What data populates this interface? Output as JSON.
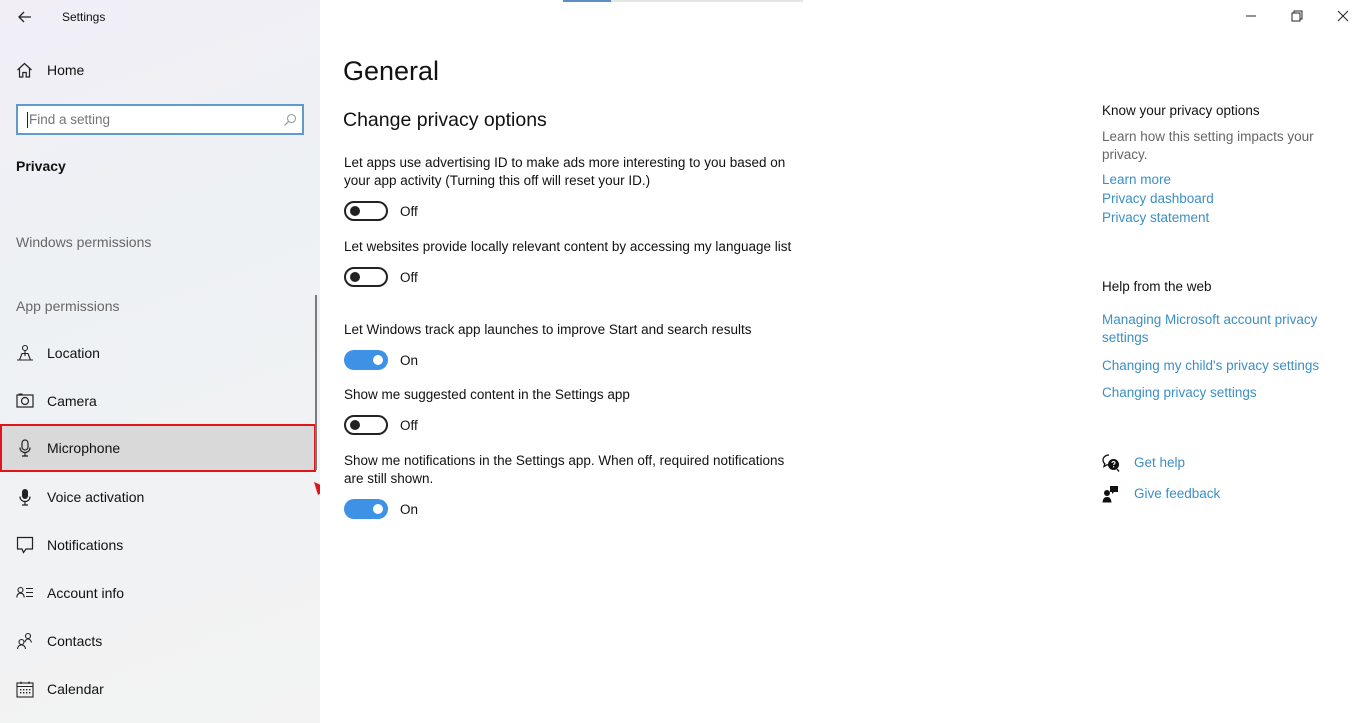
{
  "window": {
    "title": "Settings",
    "controls": {
      "minimize": "minimize",
      "restore": "restore",
      "close": "close"
    }
  },
  "sidebar": {
    "home_label": "Home",
    "search": {
      "placeholder": "Find a setting",
      "value": ""
    },
    "section_title": "Privacy",
    "groups": {
      "windows_permissions": "Windows permissions",
      "app_permissions": "App permissions"
    },
    "items": [
      {
        "label": "Location",
        "icon": "location-icon"
      },
      {
        "label": "Camera",
        "icon": "camera-icon"
      },
      {
        "label": "Microphone",
        "icon": "microphone-icon",
        "selected": true
      },
      {
        "label": "Voice activation",
        "icon": "voice-activation-icon"
      },
      {
        "label": "Notifications",
        "icon": "notifications-icon"
      },
      {
        "label": "Account info",
        "icon": "account-info-icon"
      },
      {
        "label": "Contacts",
        "icon": "contacts-icon"
      },
      {
        "label": "Calendar",
        "icon": "calendar-icon"
      }
    ]
  },
  "main": {
    "loading_progress_percent": 20,
    "title": "General",
    "subtitle": "Change privacy options",
    "options": [
      {
        "description": "Let apps use advertising ID to make ads more interesting to you based on your app activity (Turning this off will reset your ID.)",
        "state": "Off",
        "on": false
      },
      {
        "description": "Let websites provide locally relevant content by accessing my language list",
        "state": "Off",
        "on": false
      },
      {
        "description": "Let Windows track app launches to improve Start and search results",
        "state": "On",
        "on": true
      },
      {
        "description": "Show me suggested content in the Settings app",
        "state": "Off",
        "on": false
      },
      {
        "description": "Show me notifications in the Settings app. When off, required notifications are still shown.",
        "state": "On",
        "on": true
      }
    ]
  },
  "right_panel": {
    "know": {
      "heading": "Know your privacy options",
      "text": "Learn how this setting impacts your privacy.",
      "links": [
        "Learn more",
        "Privacy dashboard",
        "Privacy statement"
      ]
    },
    "help": {
      "heading": "Help from the web",
      "links": [
        "Managing Microsoft account privacy settings",
        "Changing my child's privacy settings",
        "Changing privacy settings"
      ]
    },
    "get_help": "Get help",
    "give_feedback": "Give feedback"
  },
  "colors": {
    "accent": "#3d92e6",
    "link": "#3b8fc4",
    "highlight_annotation": "#e0151b"
  }
}
